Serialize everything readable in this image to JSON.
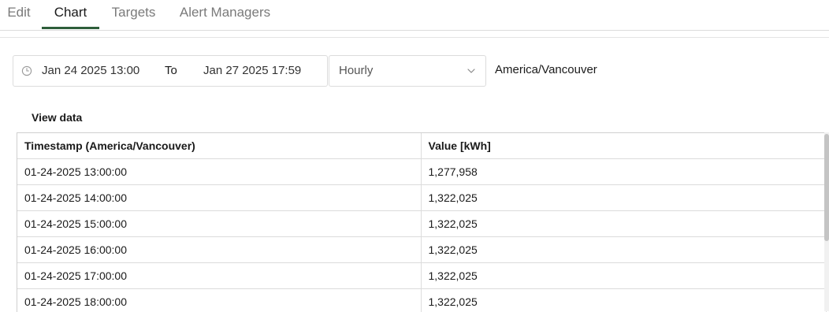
{
  "tabs": [
    {
      "label": "Edit",
      "active": false
    },
    {
      "label": "Chart",
      "active": true
    },
    {
      "label": "Targets",
      "active": false
    },
    {
      "label": "Alert Managers",
      "active": false
    }
  ],
  "date_range": {
    "icon": "clock-icon",
    "from": "Jan 24 2025 13:00",
    "separator": "To",
    "to": "Jan 27 2025 17:59"
  },
  "interval": {
    "value": "Hourly",
    "icon": "chevron-down-icon"
  },
  "timezone": "America/Vancouver",
  "view_data": {
    "title": "View data",
    "columns": [
      "Timestamp (America/Vancouver)",
      "Value [kWh]"
    ],
    "rows": [
      [
        "01-24-2025 13:00:00",
        "1,277,958"
      ],
      [
        "01-24-2025 14:00:00",
        "1,322,025"
      ],
      [
        "01-24-2025 15:00:00",
        "1,322,025"
      ],
      [
        "01-24-2025 16:00:00",
        "1,322,025"
      ],
      [
        "01-24-2025 17:00:00",
        "1,322,025"
      ],
      [
        "01-24-2025 18:00:00",
        "1,322,025"
      ]
    ]
  },
  "colors": {
    "active_tab_underline": "#2e5e3a",
    "border": "#dcdcdc",
    "muted_text": "#7a7a7a"
  }
}
